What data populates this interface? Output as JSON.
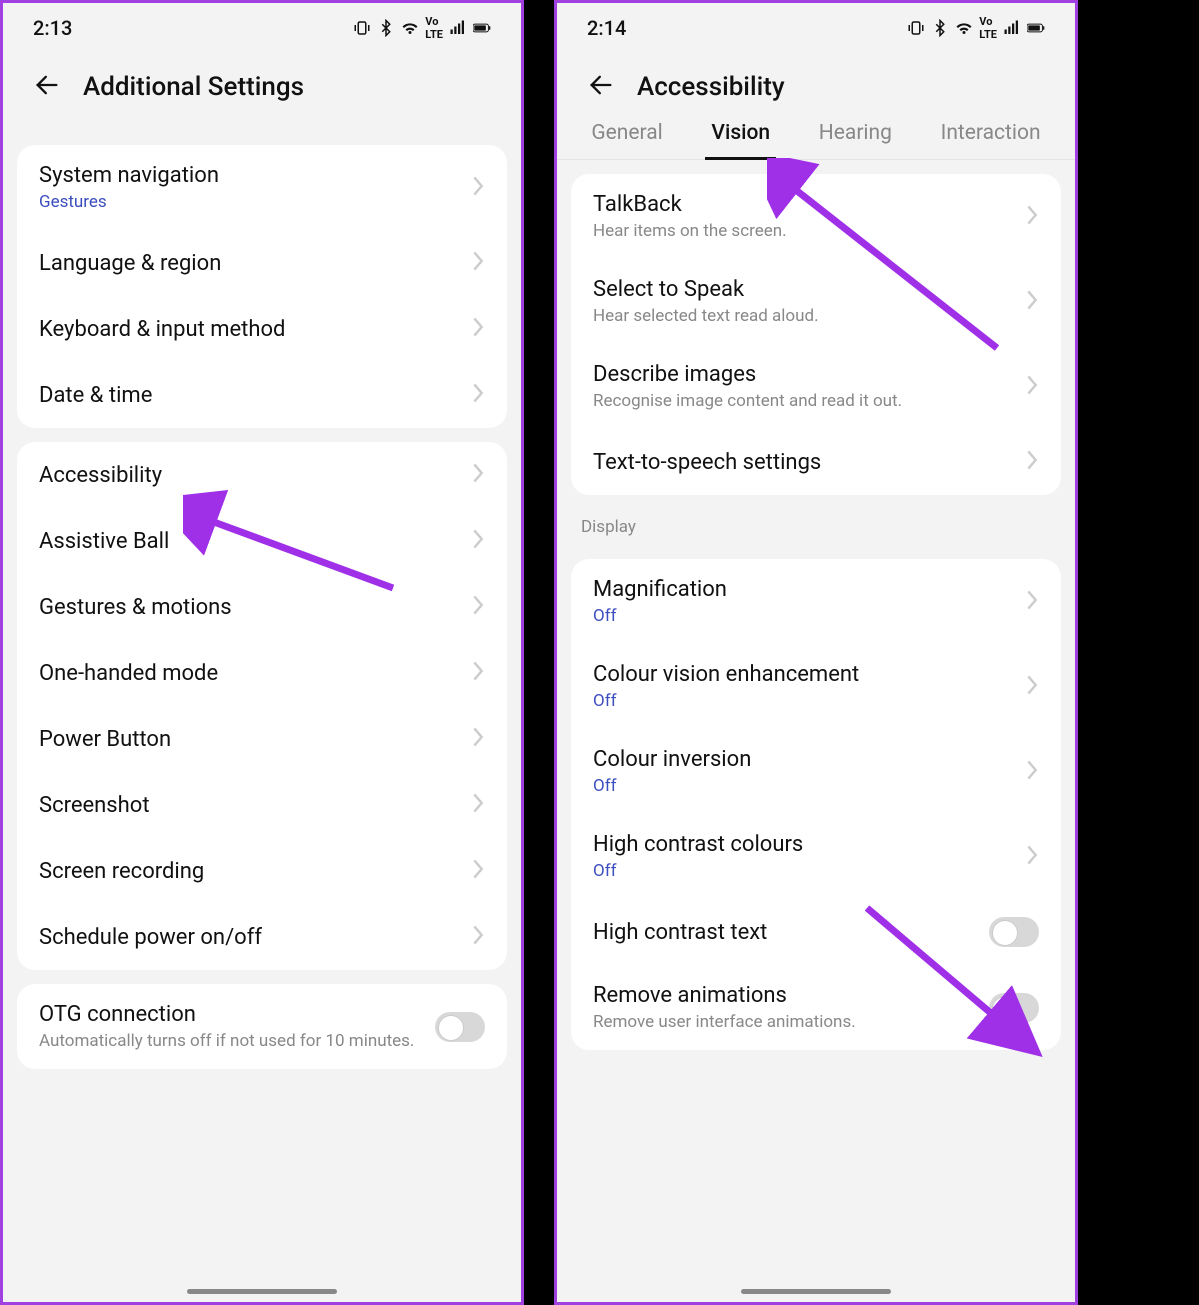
{
  "left": {
    "status": {
      "time": "2:13"
    },
    "header": {
      "title": "Additional Settings"
    },
    "groups": [
      {
        "items": [
          {
            "title": "System navigation",
            "sub": "Gestures",
            "subBlue": true,
            "chev": true
          },
          {
            "title": "Language & region",
            "chev": true
          },
          {
            "title": "Keyboard & input method",
            "chev": true
          },
          {
            "title": "Date & time",
            "chev": true
          }
        ]
      },
      {
        "items": [
          {
            "title": "Accessibility",
            "chev": true
          },
          {
            "title": "Assistive Ball",
            "chev": true
          },
          {
            "title": "Gestures & motions",
            "chev": true
          },
          {
            "title": "One-handed mode",
            "chev": true
          },
          {
            "title": "Power Button",
            "chev": true
          },
          {
            "title": "Screenshot",
            "chev": true
          },
          {
            "title": "Screen recording",
            "chev": true
          },
          {
            "title": "Schedule power on/off",
            "chev": true
          }
        ]
      },
      {
        "items": [
          {
            "title": "OTG connection",
            "sub": "Automatically turns off if not used for 10 minutes.",
            "toggle": true
          }
        ]
      }
    ]
  },
  "right": {
    "status": {
      "time": "2:14"
    },
    "header": {
      "title": "Accessibility"
    },
    "tabs": [
      "General",
      "Vision",
      "Hearing",
      "Interaction"
    ],
    "activeTab": 1,
    "groups": [
      {
        "items": [
          {
            "title": "TalkBack",
            "sub": "Hear items on the screen.",
            "chev": true
          },
          {
            "title": "Select to Speak",
            "sub": "Hear selected text read aloud.",
            "chev": true
          },
          {
            "title": "Describe images",
            "sub": "Recognise image content and read it out.",
            "chev": true
          },
          {
            "title": "Text-to-speech settings",
            "chev": true
          }
        ]
      },
      {
        "label": "Display",
        "items": [
          {
            "title": "Magnification",
            "sub": "Off",
            "subBlue": true,
            "chev": true
          },
          {
            "title": "Colour vision enhancement",
            "sub": "Off",
            "subBlue": true,
            "chev": true
          },
          {
            "title": "Colour inversion",
            "sub": "Off",
            "subBlue": true,
            "chev": true
          },
          {
            "title": "High contrast colours",
            "sub": "Off",
            "subBlue": true,
            "chev": true
          },
          {
            "title": "High contrast text",
            "toggle": true
          },
          {
            "title": "Remove animations",
            "sub": "Remove user interface animations.",
            "toggle": true
          }
        ]
      }
    ]
  }
}
